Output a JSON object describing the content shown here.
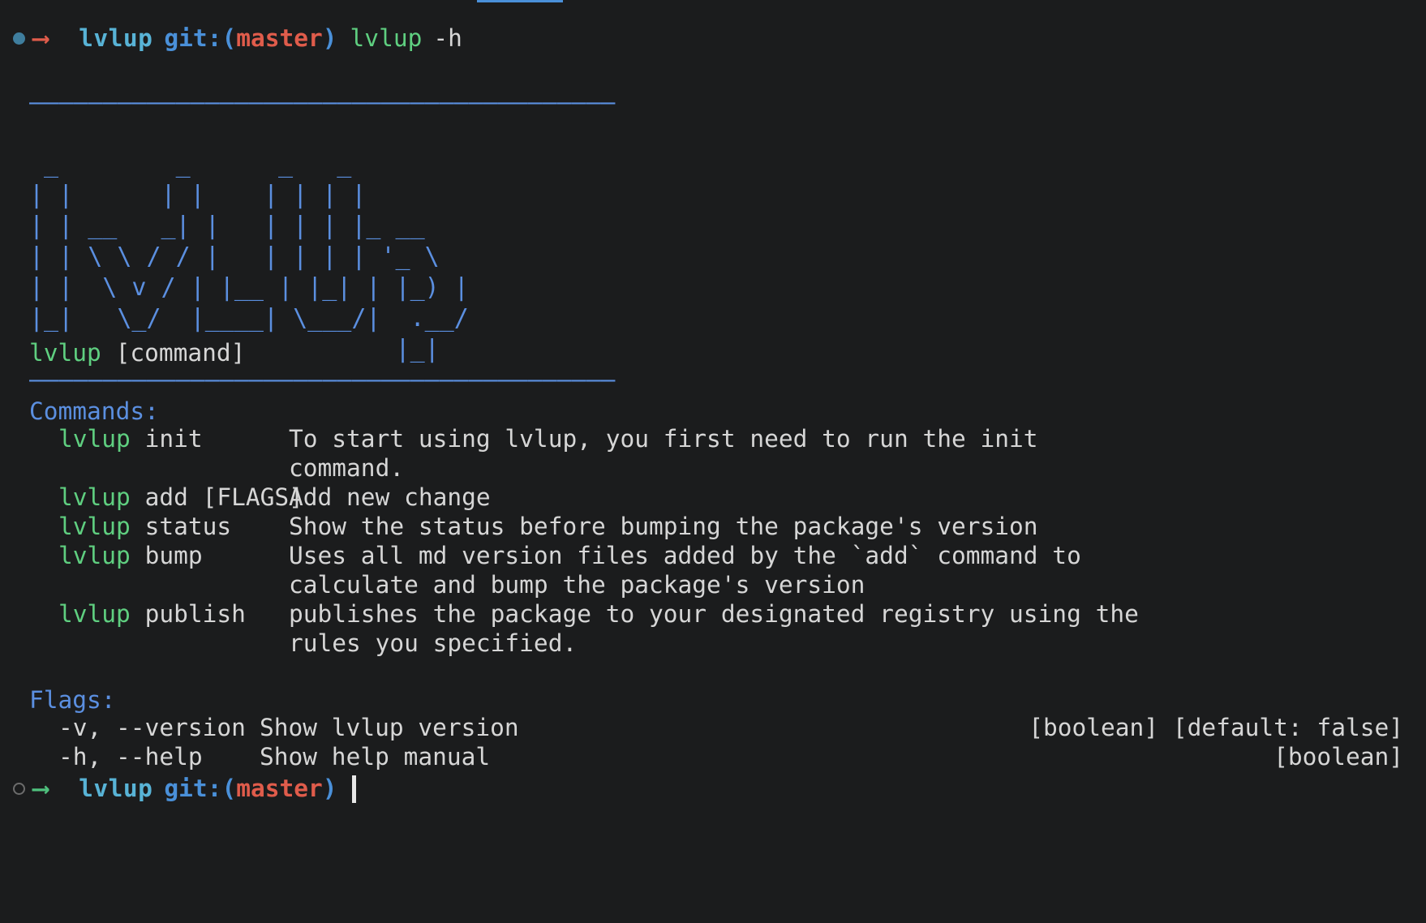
{
  "terminal": {
    "background_color": "#1b1c1d",
    "foreground_color": "#d6d6d6",
    "accent_color": "#5b8fe0",
    "command_color": "#5fcf80",
    "branch_color": "#e05c4b"
  },
  "prompt_first": {
    "bullet_icon": "filled-circle-icon",
    "arrow_icon": "arrow-right-icon",
    "directory": "lvlup",
    "git_label": "git",
    "colon": ":",
    "paren_open": "(",
    "branch": "master",
    "paren_close": ")",
    "command": "lvlup",
    "argument": "-h"
  },
  "prompt_last": {
    "bullet_icon": "hollow-circle-icon",
    "arrow_icon": "arrow-right-icon",
    "directory": "lvlup",
    "git_label": "git",
    "colon": ":",
    "paren_open": "(",
    "branch": "master",
    "paren_close": ")",
    "command": "",
    "cursor_icon": "block-cursor-icon"
  },
  "banner": {
    "rule_top": "————————————————————————————————————————",
    "rule_bottom": "————————————————————————————————————————",
    "art_lines": [
      " _        _      _   _      ",
      "| |      | |    | | | |     ",
      "| | __   _| |   | | | |_ __  ",
      "| | \\ \\ / / |   | | | | '_ \\ ",
      "| |  \\ v / | |__ | |_| | |_) |",
      "|_|   \\_/  |____| \\___/|  .__/ ",
      "                         |_|  "
    ],
    "word": "lvlup"
  },
  "usage": {
    "binary": "lvlup",
    "argument": "[command]"
  },
  "commands_section": {
    "title": "Commands:",
    "items": [
      {
        "binary": "lvlup",
        "sub": " init",
        "description": "To start using lvlup, you first need to run the init\ncommand."
      },
      {
        "binary": "lvlup",
        "sub": " add [FLAGS]",
        "description": "Add new change"
      },
      {
        "binary": "lvlup",
        "sub": " status",
        "description": "Show the status before bumping the package's version"
      },
      {
        "binary": "lvlup",
        "sub": " bump",
        "description": "Uses all md version files added by the `add` command to\ncalculate and bump the package's version"
      },
      {
        "binary": "lvlup",
        "sub": " publish",
        "description": "publishes the package to your designated registry using the\nrules you specified."
      }
    ]
  },
  "flags_section": {
    "title": "Flags:",
    "items": [
      {
        "name": "-v, --version",
        "description": "Show lvlup version",
        "meta": "[boolean] [default: false]"
      },
      {
        "name": "-h, --help",
        "description": "Show help manual",
        "meta": "[boolean]"
      }
    ]
  }
}
